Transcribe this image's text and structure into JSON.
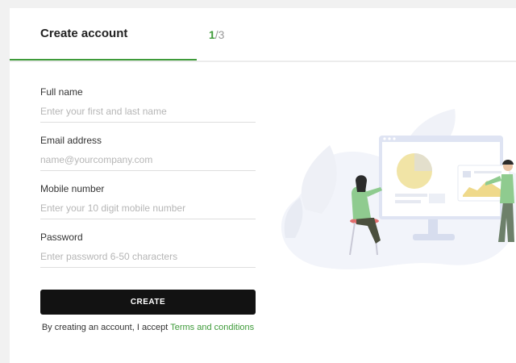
{
  "header": {
    "title": "Create account",
    "step_current": "1",
    "step_total": "/3"
  },
  "form": {
    "fields": [
      {
        "label": "Full name",
        "placeholder": "Enter your first and last name"
      },
      {
        "label": "Email address",
        "placeholder": "name@yourcompany.com"
      },
      {
        "label": "Mobile number",
        "placeholder": "Enter your 10 digit mobile number"
      },
      {
        "label": "Password",
        "placeholder": "Enter password 6-50 characters"
      }
    ],
    "submit_label": "CREATE",
    "terms_prefix": "By creating an account, I accept ",
    "terms_link": "Terms and conditions"
  },
  "colors": {
    "accent": "#3f9b3a",
    "button": "#121212"
  }
}
